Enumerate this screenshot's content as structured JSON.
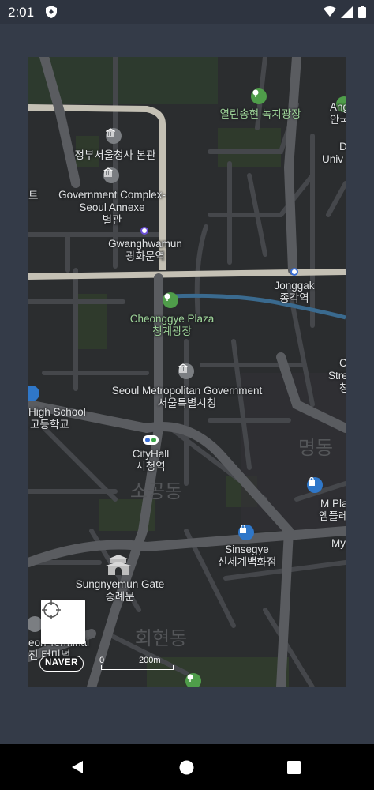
{
  "status_bar": {
    "time": "2:01"
  },
  "map": {
    "labels": [
      {
        "id": "jeongbu",
        "text": "정부서울청사 본관",
        "style": ""
      },
      {
        "id": "govcomplex-en1",
        "text": "Government Complex-",
        "style": ""
      },
      {
        "id": "govcomplex-en2",
        "text": "Seoul Annexe",
        "style": ""
      },
      {
        "id": "govcomplex-ko",
        "text": "별관",
        "style": ""
      },
      {
        "id": "gwanghwamun-en",
        "text": "Gwanghwamun",
        "style": ""
      },
      {
        "id": "gwanghwamun-ko",
        "text": "광화문역",
        "style": ""
      },
      {
        "id": "yeollin-ko",
        "text": "열린송현 녹지광장",
        "style": "green"
      },
      {
        "id": "ang",
        "text": "Ang",
        "style": ""
      },
      {
        "id": "an",
        "text": "안국",
        "style": ""
      },
      {
        "id": "d",
        "text": "D",
        "style": ""
      },
      {
        "id": "univ",
        "text": "Univ",
        "style": ""
      },
      {
        "id": "jonggak-en",
        "text": "Jonggak",
        "style": ""
      },
      {
        "id": "jonggak-ko",
        "text": "종각역",
        "style": ""
      },
      {
        "id": "cheonggye-en",
        "text": "Cheonggye Plaza",
        "style": "green"
      },
      {
        "id": "cheonggye-ko",
        "text": "청계광장",
        "style": "green"
      },
      {
        "id": "cityhall-gov-en",
        "text": "Seoul Metropolitan Government",
        "style": ""
      },
      {
        "id": "cityhall-gov-ko",
        "text": "서울특별시청",
        "style": ""
      },
      {
        "id": "c",
        "text": "C",
        "style": ""
      },
      {
        "id": "stre",
        "text": "Stre",
        "style": ""
      },
      {
        "id": "cheong",
        "text": "청",
        "style": ""
      },
      {
        "id": "highschool-en",
        "text": "High School",
        "style": ""
      },
      {
        "id": "highschool-ko",
        "text": "고등학교",
        "style": ""
      },
      {
        "id": "teu",
        "text": "트",
        "style": ""
      },
      {
        "id": "cityhall-en",
        "text": "CityHall",
        "style": ""
      },
      {
        "id": "cityhall-ko",
        "text": "시청역",
        "style": ""
      },
      {
        "id": "sogong",
        "text": "소공동",
        "style": "big"
      },
      {
        "id": "myeongdong",
        "text": "명동",
        "style": "big"
      },
      {
        "id": "mplaza-en",
        "text": "M Pla",
        "style": ""
      },
      {
        "id": "mplaza-ko",
        "text": "엠플레",
        "style": ""
      },
      {
        "id": "my",
        "text": "My",
        "style": ""
      },
      {
        "id": "sinsegye-en",
        "text": "Sinsegye",
        "style": ""
      },
      {
        "id": "sinsegye-ko",
        "text": "신세계백화점",
        "style": ""
      },
      {
        "id": "sungnyemun-en",
        "text": "Sungnyemun Gate",
        "style": ""
      },
      {
        "id": "sungnyemun-ko",
        "text": "숭례문",
        "style": ""
      },
      {
        "id": "hoehyeon",
        "text": "회현동",
        "style": "big"
      },
      {
        "id": "terminal-en",
        "text": "eon Terminal",
        "style": ""
      },
      {
        "id": "terminal-ko",
        "text": "전 터미널",
        "style": ""
      }
    ],
    "logo": "NAVER",
    "scale": {
      "start": "0",
      "end": "200m"
    }
  },
  "colors": {
    "map_background": "#2b2d2f",
    "major_road": "#c4c0b4",
    "minor_road": "#45474b",
    "park": "#2f3a2c",
    "stream": "#3a6a8f",
    "app_background": "#343b48"
  }
}
